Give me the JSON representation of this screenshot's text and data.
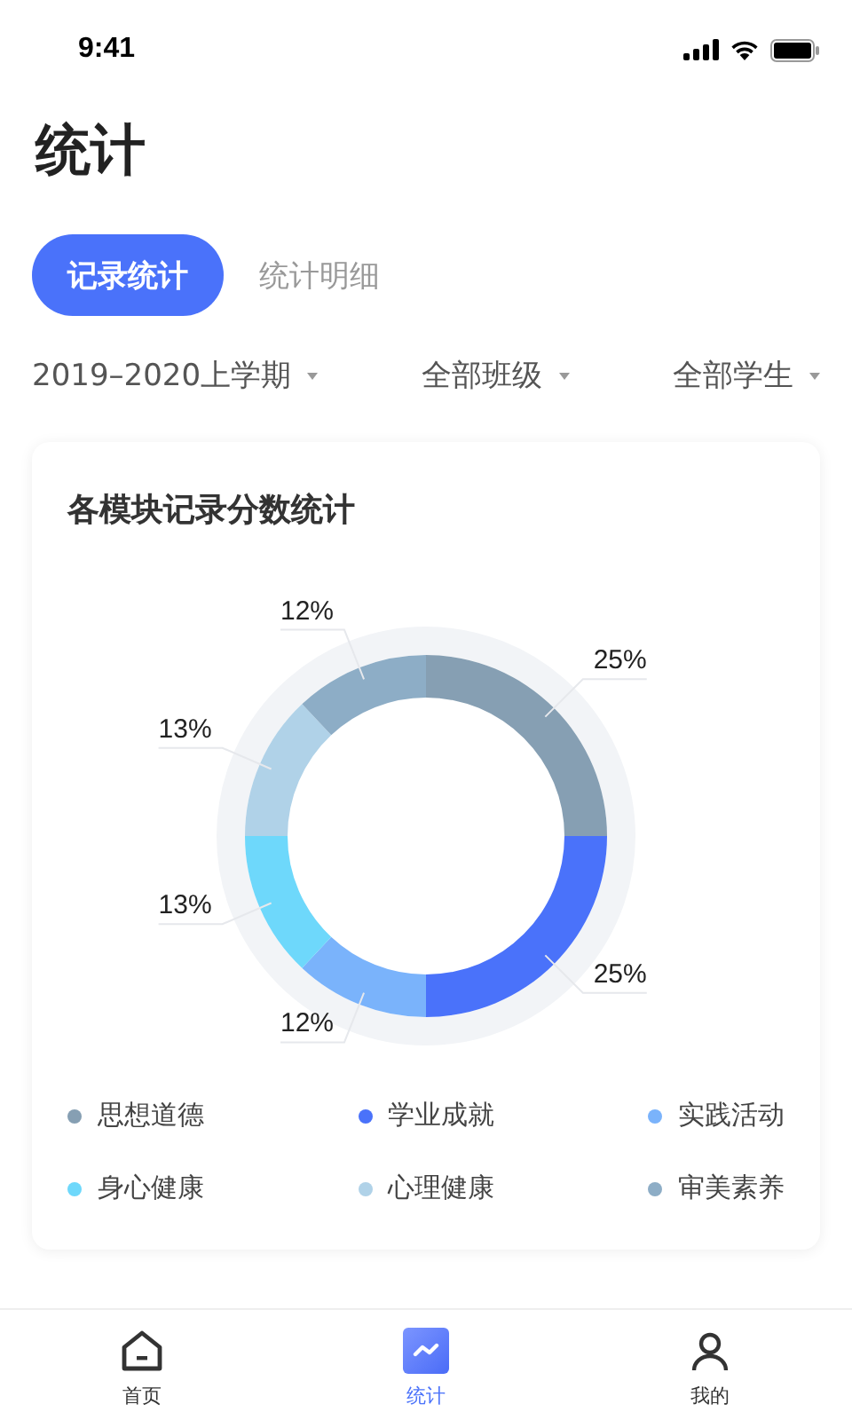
{
  "status_bar": {
    "time": "9:41"
  },
  "page_title": "统计",
  "tabs": [
    {
      "label": "记录统计",
      "selected": true
    },
    {
      "label": "统计明细",
      "selected": false
    }
  ],
  "filters": [
    {
      "label": "2019–2020上学期"
    },
    {
      "label": "全部班级"
    },
    {
      "label": "全部学生"
    }
  ],
  "card": {
    "title": "各模块记录分数统计",
    "chart_data": {
      "type": "donut",
      "values": [
        25,
        25,
        12,
        13,
        13,
        12
      ],
      "value_labels": [
        "25%",
        "25%",
        "12%",
        "13%",
        "13%",
        "12%"
      ]
    },
    "legend": [
      {
        "label": "思想道德",
        "color": "#869fb3"
      },
      {
        "label": "学业成就",
        "color": "#4a72fa"
      },
      {
        "label": "实践活动",
        "color": "#7ab3fb"
      },
      {
        "label": "身心健康",
        "color": "#6ed8fb"
      },
      {
        "label": "心理健康",
        "color": "#b0d2e8"
      },
      {
        "label": "审美素养",
        "color": "#8dadc6"
      }
    ]
  },
  "tab_bar": [
    {
      "kind": "home",
      "label": "首页",
      "selected": false
    },
    {
      "kind": "chart",
      "label": "统计",
      "selected": true
    },
    {
      "kind": "person",
      "label": "我的",
      "selected": false
    }
  ]
}
